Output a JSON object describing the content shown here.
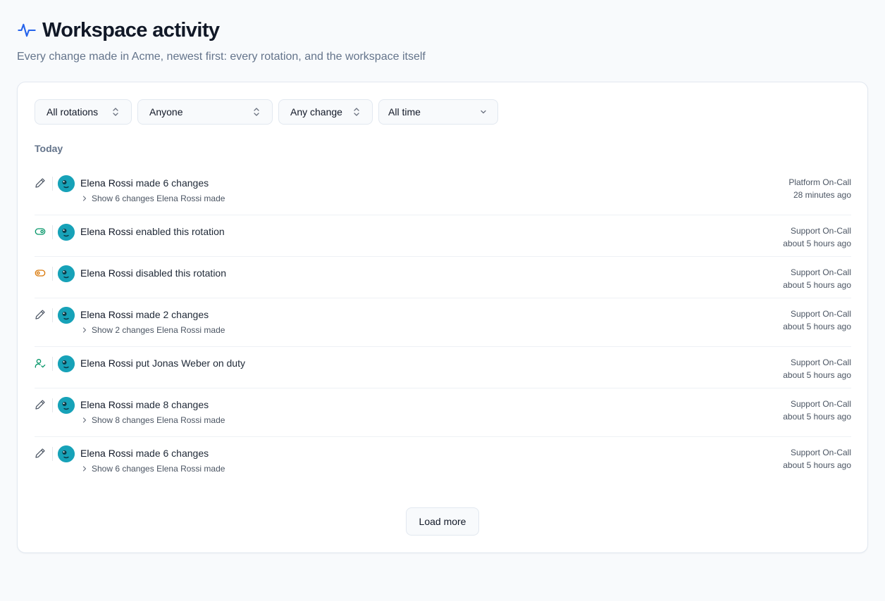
{
  "header": {
    "title": "Workspace activity",
    "subtitle": "Every change made in Acme, newest first: every rotation, and the workspace itself",
    "icon": "activity-pulse-icon"
  },
  "filters": [
    {
      "label": "All rotations",
      "icon": "chevron-up-down-icon"
    },
    {
      "label": "Anyone",
      "icon": "chevron-up-down-icon"
    },
    {
      "label": "Any change",
      "icon": "chevron-up-down-icon"
    },
    {
      "label": "All time",
      "icon": "chevron-down-icon"
    }
  ],
  "section": {
    "label": "Today"
  },
  "events": [
    {
      "icon": "pencil-icon",
      "actor": "Elena Rossi",
      "action": " made 6 changes",
      "expand": "Show 6 changes Elena Rossi made",
      "rotation": "Platform On-Call",
      "time": "28 minutes ago"
    },
    {
      "icon": "toggle-on-icon",
      "actor": "Elena Rossi",
      "action": " enabled this rotation",
      "expand": "",
      "rotation": "Support On-Call",
      "time": "about 5 hours ago"
    },
    {
      "icon": "toggle-off-icon",
      "actor": "Elena Rossi",
      "action": " disabled this rotation",
      "expand": "",
      "rotation": "Support On-Call",
      "time": "about 5 hours ago"
    },
    {
      "icon": "pencil-icon",
      "actor": "Elena Rossi",
      "action": " made 2 changes",
      "expand": "Show 2 changes Elena Rossi made",
      "rotation": "Support On-Call",
      "time": "about 5 hours ago"
    },
    {
      "icon": "user-check-icon",
      "actor": "Elena Rossi",
      "action": " put Jonas Weber on duty",
      "expand": "",
      "rotation": "Support On-Call",
      "time": "about 5 hours ago"
    },
    {
      "icon": "pencil-icon",
      "actor": "Elena Rossi",
      "action": " made 8 changes",
      "expand": "Show 8 changes Elena Rossi made",
      "rotation": "Support On-Call",
      "time": "about 5 hours ago"
    },
    {
      "icon": "pencil-icon",
      "actor": "Elena Rossi",
      "action": " made 6 changes",
      "expand": "Show 6 changes Elena Rossi made",
      "rotation": "Support On-Call",
      "time": "about 5 hours ago"
    }
  ],
  "load_more": {
    "label": "Load more"
  },
  "colors": {
    "accent": "#2563eb",
    "enabled": "#059669",
    "disabled": "#d97706",
    "avatar": "#17a2b8"
  }
}
